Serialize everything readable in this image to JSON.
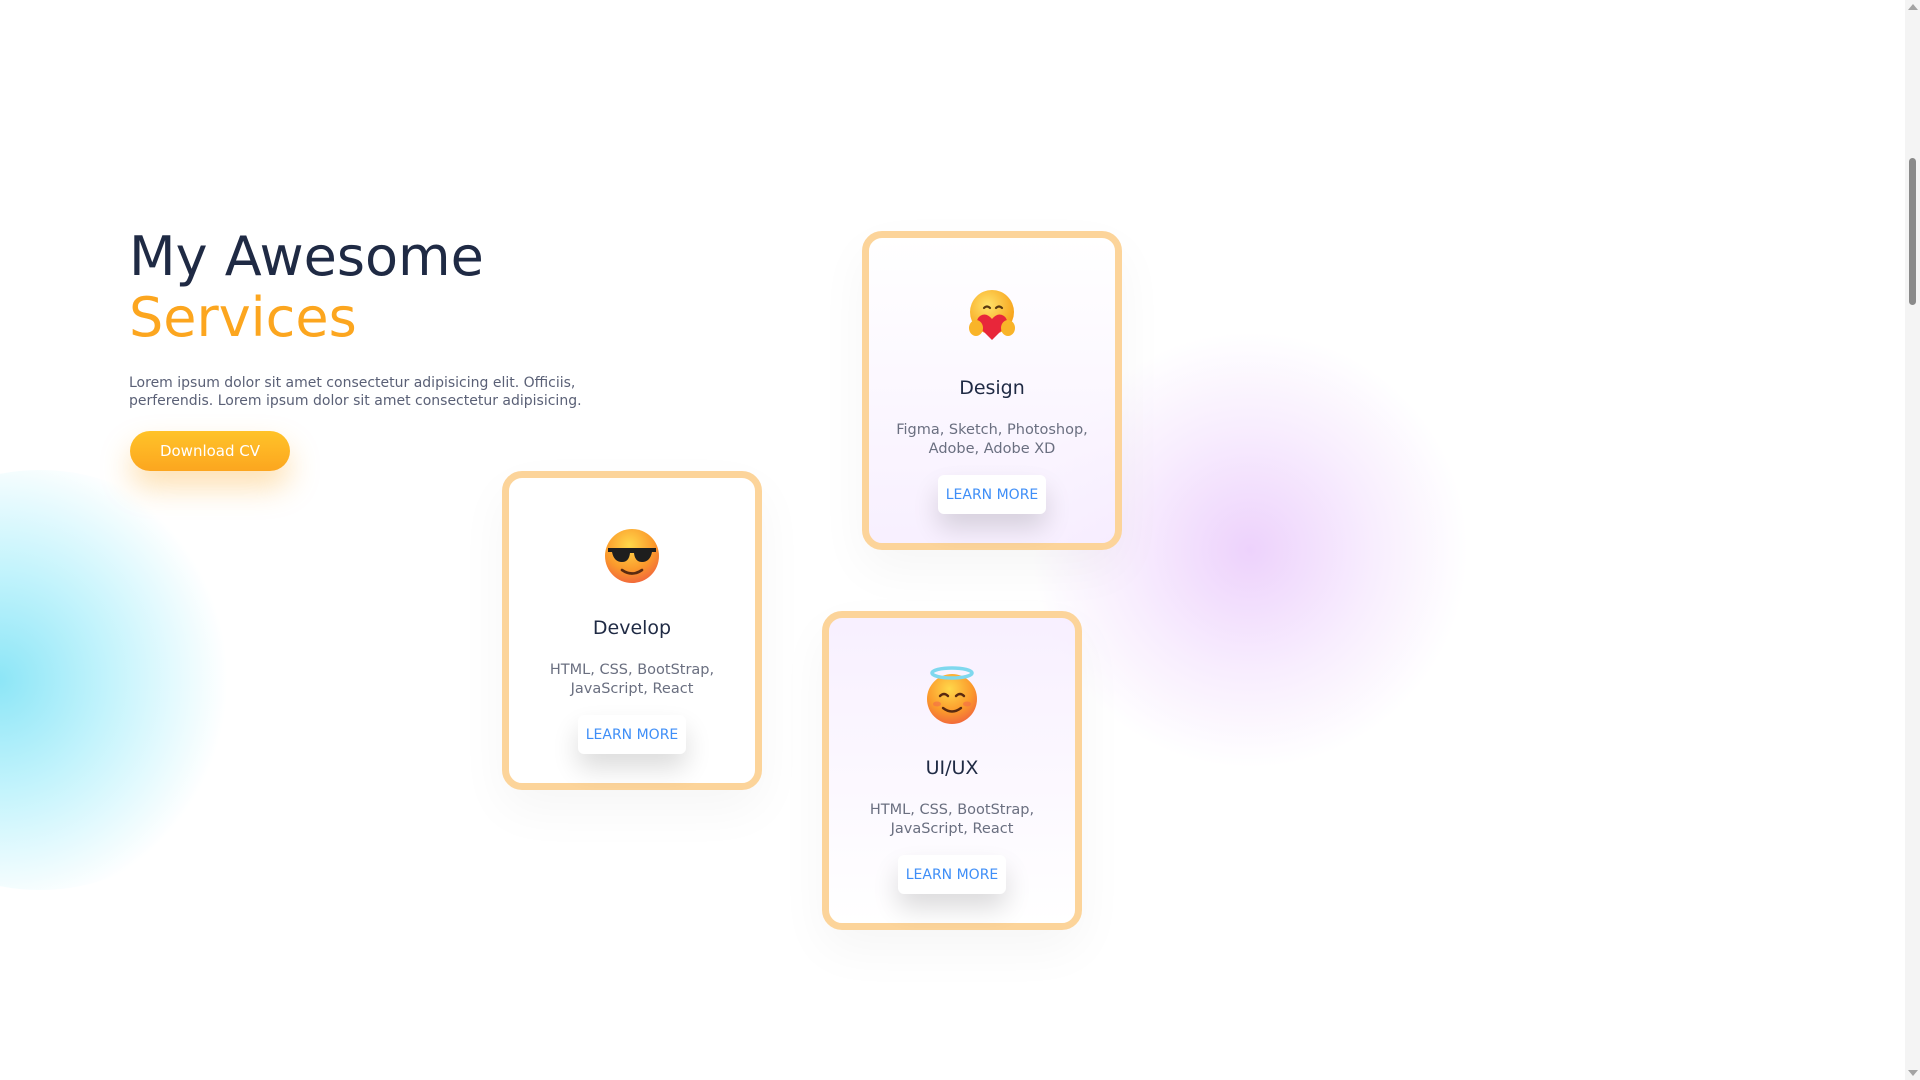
{
  "services": {
    "heading_line1": "My Awesome",
    "heading_line2": "Services",
    "description": "Lorem ipsum dolor sit amet consectetur adipisicing elit. Officiis, perferendis. Lorem ipsum dolor sit amet consectetur adipisicing.",
    "download_label": "Download CV",
    "accent_color": "#fca61f",
    "heading_color": "#1f2a44",
    "cards": [
      {
        "icon": "hugging-heart-emoji-icon",
        "title": "Design",
        "text": "Figma, Sketch, Photoshop, Adobe, Adobe XD",
        "button": "LEARN MORE"
      },
      {
        "icon": "sunglasses-emoji-icon",
        "title": "Develop",
        "text": "HTML, CSS, BootStrap, JavaScript, React",
        "button": "LEARN MORE"
      },
      {
        "icon": "halo-emoji-icon",
        "title": "UI/UX",
        "text": "HTML, CSS, BootStrap, JavaScript, React",
        "button": "LEARN MORE"
      }
    ],
    "card_border_color": "#fcd49a",
    "link_color": "#3e8ef7"
  }
}
